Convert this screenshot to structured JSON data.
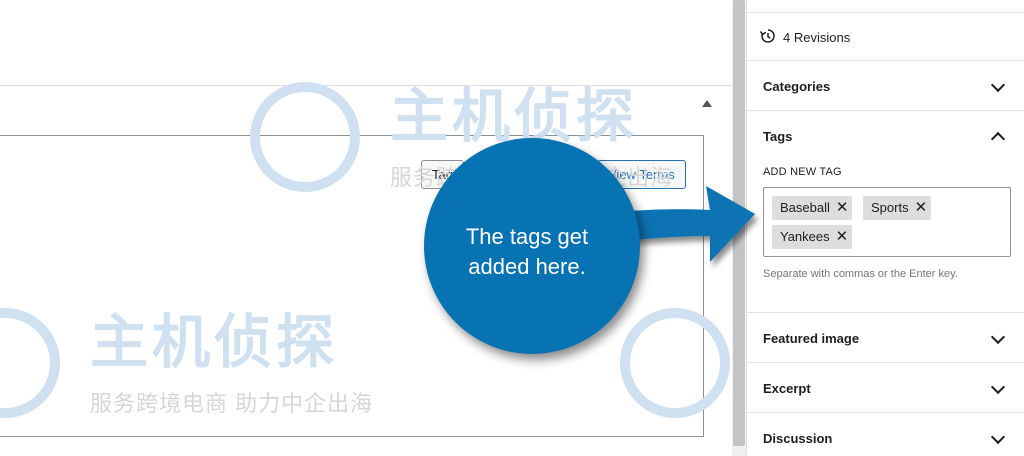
{
  "editor": {
    "tags_button": "Tag",
    "view_terms_button": "View Terms"
  },
  "sidebar": {
    "revisions": "4 Revisions",
    "panels": [
      {
        "title": "Categories",
        "state": "collapsed"
      },
      {
        "title": "Tags",
        "state": "expanded"
      },
      {
        "title": "Featured image",
        "state": "collapsed"
      },
      {
        "title": "Excerpt",
        "state": "collapsed"
      },
      {
        "title": "Discussion",
        "state": "collapsed"
      }
    ],
    "tags": {
      "add_label": "ADD NEW TAG",
      "tokens": [
        "Baseball",
        "Sports",
        "Yankees"
      ],
      "remove_glyph": "✕",
      "help": "Separate with commas or the Enter key."
    }
  },
  "callout": {
    "line1": "The tags get",
    "line2": "added here.",
    "color": "#0873b3"
  },
  "watermark": {
    "title": "主机侦探",
    "subtitle": "服务跨境电商 助力中企出海"
  },
  "icons": {
    "revisions": "history-icon",
    "chevrons": "chevron-icon",
    "remove": "close-icon"
  }
}
